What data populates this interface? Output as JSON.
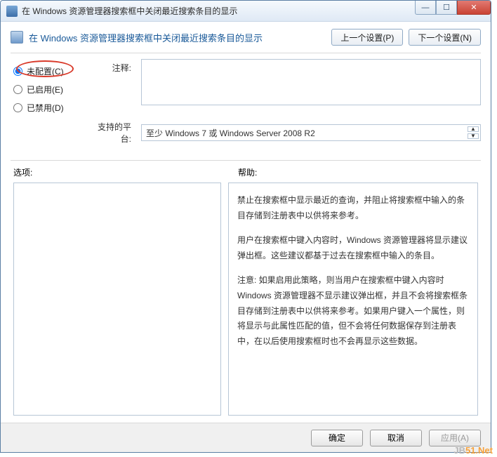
{
  "window": {
    "title": "在 Windows 资源管理器搜索框中关闭最近搜索条目的显示"
  },
  "header": {
    "title": "在 Windows 资源管理器搜索框中关闭最近搜索条目的显示",
    "prev_button": "上一个设置(P)",
    "next_button": "下一个设置(N)"
  },
  "radios": {
    "not_configured": "未配置(C)",
    "enabled": "已启用(E)",
    "disabled": "已禁用(D)",
    "selected": "not_configured"
  },
  "labels": {
    "comment": "注释:",
    "supported": "支持的平台:",
    "options": "选项:",
    "help": "帮助:"
  },
  "supported_on": "至少 Windows 7 或 Windows Server 2008 R2",
  "help_paragraphs": [
    "禁止在搜索框中显示最近的查询，并阻止将搜索框中输入的条目存储到注册表中以供将来参考。",
    "用户在搜索框中键入内容时，Windows 资源管理器将显示建议弹出框。这些建议都基于过去在搜索框中输入的条目。",
    "注意: 如果启用此策略，则当用户在搜索框中键入内容时 Windows 资源管理器不显示建议弹出框，并且不会将搜索框条目存储到注册表中以供将来参考。如果用户键入一个属性，则将显示与此属性匹配的值，但不会将任何数据保存到注册表中，在以后使用搜索框时也不会再显示这些数据。"
  ],
  "footer": {
    "ok": "确定",
    "cancel": "取消",
    "apply": "应用(A)"
  },
  "watermark": {
    "prefix": "JB",
    "suffix": "51.Net"
  },
  "window_controls": {
    "minimize": "—",
    "maximize": "☐",
    "close": "✕"
  }
}
